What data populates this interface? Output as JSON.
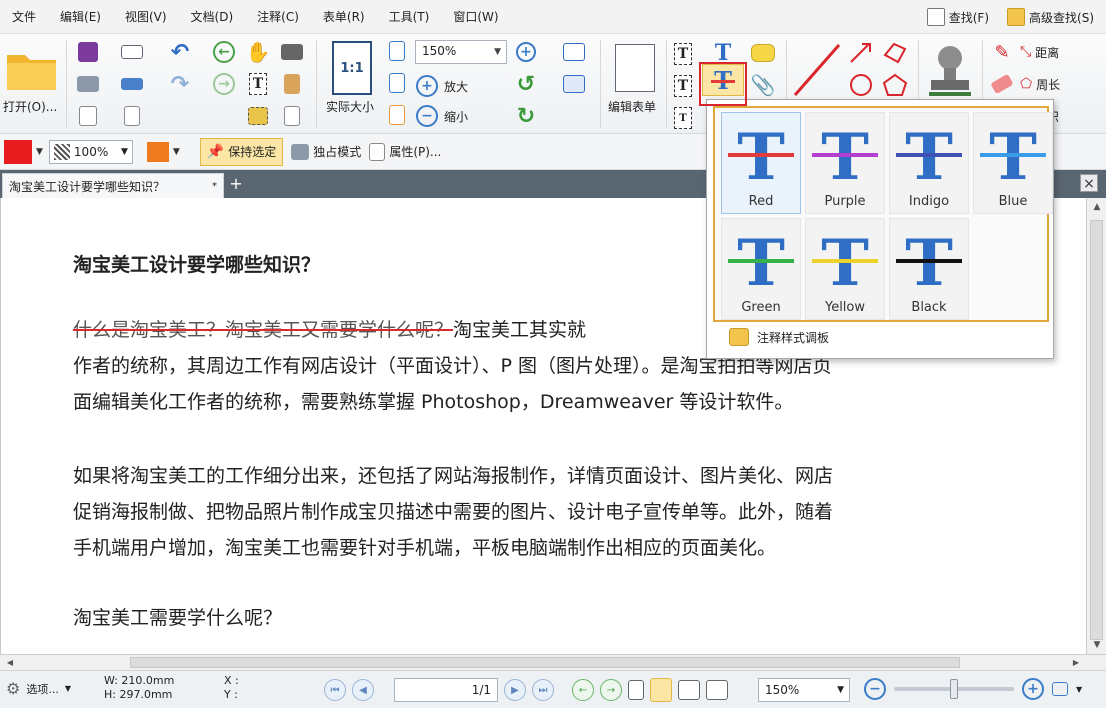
{
  "menu": {
    "items": [
      "文件",
      "编辑(E)",
      "视图(V)",
      "文档(D)",
      "注释(C)",
      "表单(R)",
      "工具(T)",
      "窗口(W)"
    ],
    "find": "查找(F)",
    "advanced_find": "高级查找(S)"
  },
  "ribbon": {
    "open_label": "打开(O)...",
    "actual_size": "实际大小",
    "actual_size_icon": "1:1",
    "zoom_value": "150%",
    "zoom_in": "放大",
    "zoom_out": "缩小",
    "edit_form": "编辑表单",
    "distance": "距离",
    "perimeter": "周长",
    "area": "面积"
  },
  "toolbar2": {
    "stroke_color": "#e81c1c",
    "opacity": "100%",
    "fill_color": "#ee7b1d",
    "keep_selected": "保持选定",
    "exclusive_mode": "独占模式",
    "properties": "属性(P)..."
  },
  "tab": {
    "title": "淘宝美工设计要学哪些知识？",
    "close_mark": "*"
  },
  "document": {
    "title": "淘宝美工设计要学哪些知识？",
    "para1_struck": "什么是淘宝美工？淘宝美工又需要学什么呢？",
    "para1_rest": "淘宝美工其实就",
    "para1_line2": "作者的统称，其周边工作有网店设计（平面设计）、P 图（图片处理）。是淘宝拍拍等网店页",
    "para1_line3": "面编辑美化工作者的统称，需要熟练掌握 Photoshop，Dreamweaver 等设计软件。",
    "para2_line1": "如果将淘宝美工的工作细分出来，还包括了网站海报制作，详情页面设计、图片美化、网店",
    "para2_line2": "促销海报制做、把物品照片制作成宝贝描述中需要的图片、设计电子宣传单等。此外，随着",
    "para2_line3": "手机端用户增加，淘宝美工也需要针对手机端，平板电脑端制作出相应的页面美化。",
    "para3": "淘宝美工需要学什么呢？"
  },
  "popup": {
    "styles": [
      {
        "name": "Red",
        "color": "#e23b3b"
      },
      {
        "name": "Purple",
        "color": "#b33fcf"
      },
      {
        "name": "Indigo",
        "color": "#3f51b5"
      },
      {
        "name": "Blue",
        "color": "#3a9be8"
      },
      {
        "name": "Green",
        "color": "#36b24a"
      },
      {
        "name": "Yellow",
        "color": "#ecd32b"
      },
      {
        "name": "Black",
        "color": "#111111"
      }
    ],
    "footer": "注释样式调板",
    "selected": "Red"
  },
  "statusbar": {
    "select_label": "选项...",
    "width": "W: 210.0mm",
    "height": "H: 297.0mm",
    "x_label": "X :",
    "y_label": "Y :",
    "page": "1/1",
    "zoom": "150%"
  },
  "colors": {
    "accent_blue": "#3a7cc8",
    "highlight_red": "#d9262c",
    "popup_border": "#e0a83a"
  }
}
